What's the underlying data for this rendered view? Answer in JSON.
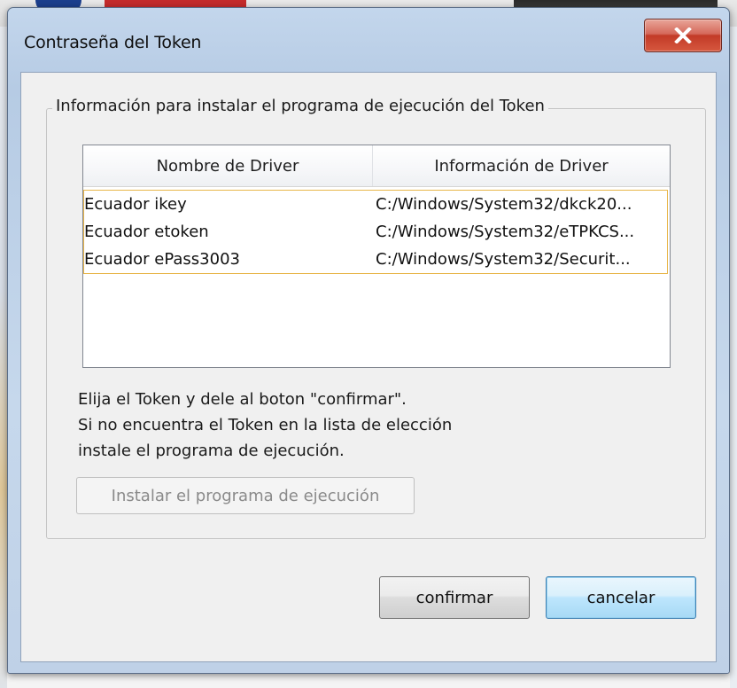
{
  "window": {
    "title": "Contraseña del Token"
  },
  "groupbox": {
    "legend": "Información para instalar el programa de ejecución del Token"
  },
  "driver_list": {
    "columns": [
      "Nombre de Driver",
      "Información de Driver"
    ],
    "rows": [
      {
        "name": "Ecuador ikey",
        "info": "C:/Windows/System32/dkck20..."
      },
      {
        "name": "Ecuador etoken",
        "info": "C:/Windows/System32/eTPKCS..."
      },
      {
        "name": "Ecuador ePass3003",
        "info": "C:/Windows/System32/Securit..."
      }
    ]
  },
  "instructions": {
    "line1": "Elija el Token y dele al boton \"confirmar\".",
    "line2": "Si no encuentra el Token en la lista de elección",
    "line3": "instale el programa de ejecución."
  },
  "buttons": {
    "install": "Instalar el programa de ejecución",
    "confirm": "confirmar",
    "cancel": "cancelar"
  },
  "icons": {
    "close": "close-icon"
  },
  "colors": {
    "close_button": "#c23a27",
    "selection_border": "#e8b64a",
    "default_button_border": "#3c7fb1"
  }
}
